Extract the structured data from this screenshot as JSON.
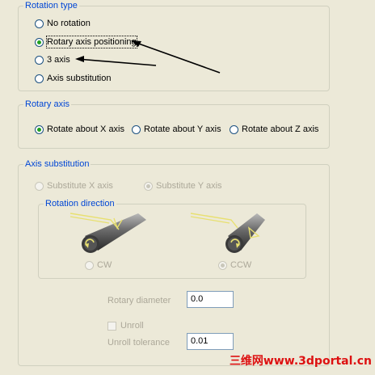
{
  "rotation_type": {
    "title": "Rotation type",
    "options": [
      {
        "label": "No rotation",
        "checked": false
      },
      {
        "label": "Rotary axis positioning",
        "checked": true
      },
      {
        "label": "3 axis",
        "checked": false
      },
      {
        "label": "Axis substitution",
        "checked": false
      }
    ]
  },
  "rotary_axis": {
    "title": "Rotary axis",
    "options": [
      {
        "label": "Rotate about X axis",
        "checked": true
      },
      {
        "label": "Rotate about Y axis",
        "checked": false
      },
      {
        "label": "Rotate about Z axis",
        "checked": false
      }
    ]
  },
  "axis_substitution": {
    "title": "Axis substitution",
    "substitute_x_label": "Substitute X axis",
    "substitute_y_label": "Substitute Y axis",
    "rotation_direction": {
      "title": "Rotation direction",
      "cw_label": "CW",
      "ccw_label": "CCW"
    },
    "rotary_diameter_label": "Rotary diameter",
    "rotary_diameter_value": "0.0",
    "unroll_label": "Unroll",
    "unroll_tolerance_label": "Unroll tolerance",
    "unroll_tolerance_value": "0.01"
  },
  "watermark": "三维网www.3dportal.cn",
  "colors": {
    "legend": "#0046d5",
    "arrow": "#000000",
    "tool_yellow": "#e8e070",
    "watermark": "#dd1111"
  }
}
